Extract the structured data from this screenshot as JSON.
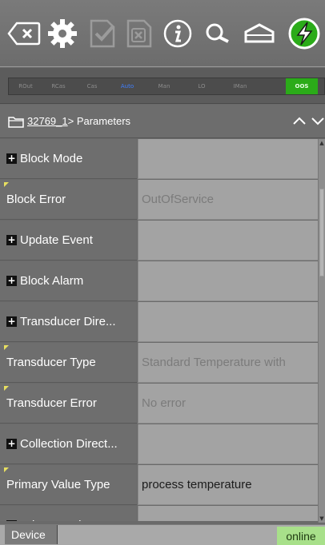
{
  "toolbar": {
    "buttons": [
      {
        "name": "backspace-icon"
      },
      {
        "name": "gear-icon"
      },
      {
        "name": "check-document-icon"
      },
      {
        "name": "cancel-document-icon"
      },
      {
        "name": "info-icon"
      },
      {
        "name": "search-icon"
      },
      {
        "name": "home-icon"
      },
      {
        "name": "lightning-icon"
      }
    ]
  },
  "modes": [
    "ROut",
    "RCas",
    "Cas",
    "Auto",
    "Man",
    "LO",
    "IMan",
    "OOS"
  ],
  "active_mode": "OOS",
  "breadcrumb": {
    "link": "32769_1",
    "rest": "> Parameters"
  },
  "rows": [
    {
      "name": "Block Mode",
      "value": "",
      "expandable": true
    },
    {
      "name": "Block Error",
      "value": "OutOfService",
      "flag": true
    },
    {
      "name": "Update Event",
      "value": "",
      "expandable": true
    },
    {
      "name": "Block Alarm",
      "value": "",
      "expandable": true
    },
    {
      "name": "Transducer Dire...",
      "value": "",
      "expandable": true
    },
    {
      "name": "Transducer Type",
      "value": "Standard Temperature with",
      "flag": true
    },
    {
      "name": "Transducer Error",
      "value": "No error",
      "flag": true
    },
    {
      "name": "Collection Direct...",
      "value": "",
      "expandable": true
    },
    {
      "name": "Primary Value Type",
      "value": "process temperature",
      "flag": true,
      "value_dark": true
    },
    {
      "name": "Primary Value",
      "value": "",
      "expandable": true
    }
  ],
  "bottom": {
    "tab": "Device",
    "status": "online"
  },
  "colors": {
    "oos": "#2bab19",
    "auto": "#3f7fff",
    "online": "#a8e08a"
  }
}
